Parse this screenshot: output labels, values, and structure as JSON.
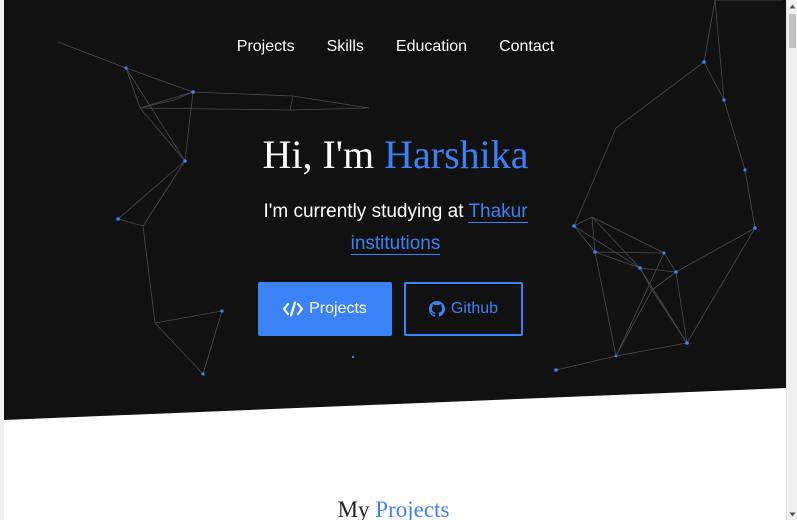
{
  "nav": {
    "items": [
      {
        "label": "Projects"
      },
      {
        "label": "Skills"
      },
      {
        "label": "Education"
      },
      {
        "label": "Contact"
      }
    ]
  },
  "hero": {
    "greeting": "Hi, I'm ",
    "name": "Harshika",
    "subtitle_prefix": "I'm currently studying at ",
    "subtitle_link": "Thakur institutions",
    "buttons": {
      "projects_label": "Projects",
      "projects_icon": "code-icon",
      "github_label": "Github",
      "github_icon": "github-icon"
    }
  },
  "projects_section": {
    "heading_prefix": "My ",
    "heading_accent": "Projects"
  },
  "colors": {
    "accent": "#3b82f6",
    "hero_background": "#111112",
    "network_lines": "#555a66",
    "network_dots": "#3b82f6"
  }
}
